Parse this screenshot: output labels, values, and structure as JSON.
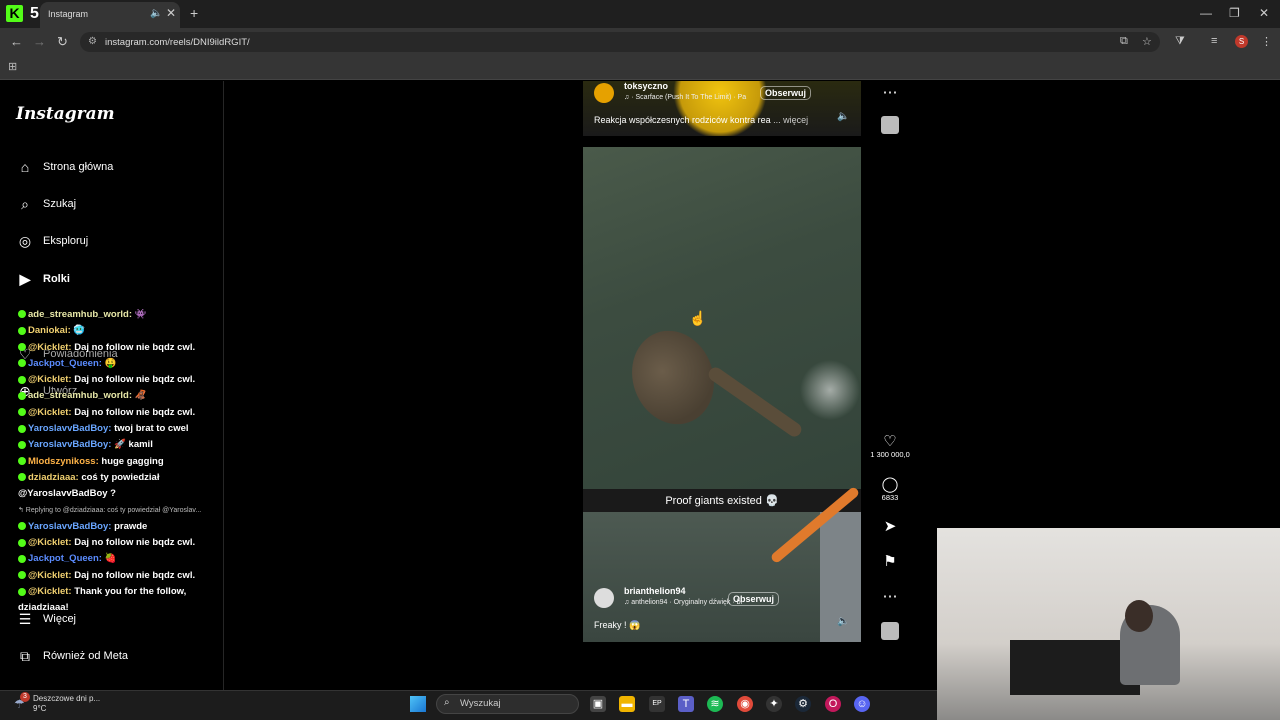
{
  "browser": {
    "tab_title": "Instagram",
    "url": "instagram.com/reels/DNI9ildRGIT/",
    "profile_initial": "S",
    "icons": [
      "kick-favicon",
      "five-favicon",
      "audio-icon",
      "close-icon",
      "new-tab-icon",
      "back-icon",
      "forward-icon",
      "reload-icon",
      "site-info-icon",
      "install-icon",
      "star-icon",
      "extensions-icon",
      "media-icon",
      "menu-icon",
      "apps-icon"
    ]
  },
  "instagram": {
    "logo": "Instagram",
    "nav": [
      {
        "label": "Strona główna",
        "icon": "home-icon"
      },
      {
        "label": "Szukaj",
        "icon": "search-icon"
      },
      {
        "label": "Eksploruj",
        "icon": "compass-icon"
      },
      {
        "label": "Rolki",
        "icon": "reels-icon"
      },
      {
        "label": "Powiadomienia",
        "icon": "heart-icon"
      },
      {
        "label": "Utwórz",
        "icon": "plus-icon"
      },
      {
        "label": "Więcej",
        "icon": "menu-icon"
      },
      {
        "label": "Również od Meta",
        "icon": "meta-icon"
      }
    ],
    "reel1": {
      "user": "toksyczno",
      "music": "♫ · Scarface (Push It To The Limit) · Pa",
      "follow": "Obserwuj",
      "description": "Reakcja współczesnych rodziców kontra rea",
      "more": "... więcej"
    },
    "video_caption": "Proof giants existed 💀",
    "reel2": {
      "user": "brianthelion94",
      "music": "♫ anthelion94 · Oryginalny dźwięk · bi",
      "follow": "Obserwuj",
      "description": "Freaky ! 😱"
    },
    "actions": {
      "likes": "1 300 000,0",
      "comments": "6833"
    }
  },
  "chat": [
    {
      "user": "ade_streamhub_world",
      "color": "#e8e8a8",
      "msg": " 👾"
    },
    {
      "user": "Daniokai",
      "color": "#f0d070",
      "msg": " 🥶"
    },
    {
      "user": "@Kicklet",
      "color": "#f0d070",
      "msg": " Daj no follow nie bqdz cwl."
    },
    {
      "user": "Jackpot_Queen",
      "color": "#5b8cff",
      "msg": " 🤑"
    },
    {
      "user": "@Kicklet",
      "color": "#f0d070",
      "msg": " Daj no follow nie bqdz cwl."
    },
    {
      "user": "ade_streamhub_world",
      "color": "#e8e8a8",
      "msg": " 🦧"
    },
    {
      "user": "@Kicklet",
      "color": "#f0d070",
      "msg": " Daj no follow nie bqdz cwl."
    },
    {
      "user": "YaroslavvBadBoy",
      "color": "#6aa6ff",
      "msg": " twoj brat to cwel"
    },
    {
      "user": "YaroslavvBadBoy",
      "color": "#6aa6ff",
      "msg": " 🚀 kamil"
    },
    {
      "user": "Mlodszynikoss",
      "color": "#ffb347",
      "msg": " huge gagging"
    },
    {
      "user": "dziadziaaa",
      "color": "#f0d070",
      "msg": " coś ty powiedział"
    },
    {
      "user": "",
      "color": "#fff",
      "msg": "@YaroslavvBadBoy ?"
    },
    {
      "user": "",
      "color": "#bbb",
      "msg": "↰ Replying to @dziadziaaa: coś ty powiedział @Yaroslav..."
    },
    {
      "user": "YaroslavvBadBoy",
      "color": "#6aa6ff",
      "msg": " prawde"
    },
    {
      "user": "@Kicklet",
      "color": "#f0d070",
      "msg": " Daj no follow nie bqdz cwl."
    },
    {
      "user": "Jackpot_Queen",
      "color": "#5b8cff",
      "msg": " 🍓"
    },
    {
      "user": "@Kicklet",
      "color": "#f0d070",
      "msg": " Daj no follow nie bqdz cwl."
    },
    {
      "user": "@Kicklet",
      "color": "#f0d070",
      "msg": " Thank you for the follow,"
    },
    {
      "user": "",
      "color": "#fff",
      "msg": "dziadziaaa!"
    }
  ],
  "taskbar": {
    "weather_title": "Deszczowe dni p...",
    "weather_temp": "9°C",
    "weather_badge": "3",
    "search_placeholder": "Wyszukaj"
  }
}
